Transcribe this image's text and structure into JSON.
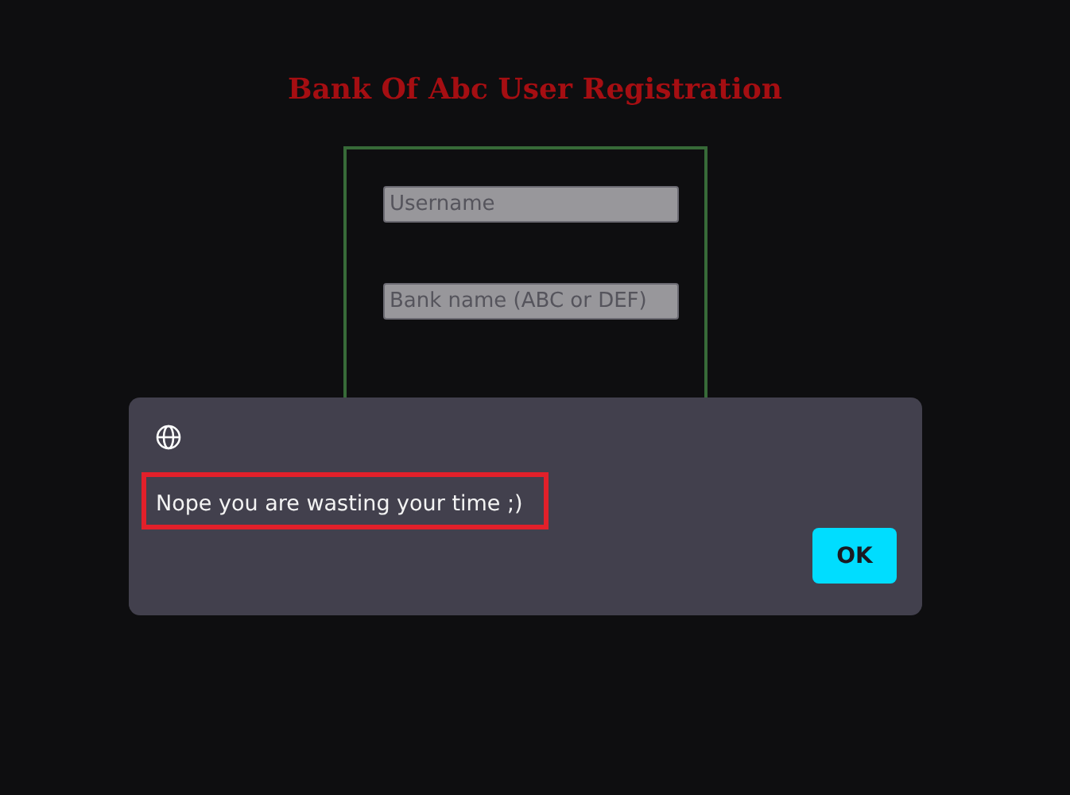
{
  "page": {
    "title": "Bank Of Abc User Registration"
  },
  "form": {
    "fields": [
      {
        "placeholder": "Username"
      },
      {
        "placeholder": "Bank name (ABC or DEF)"
      }
    ]
  },
  "dialog": {
    "message": "Nope you are wasting your time ;)",
    "highlighted": true,
    "buttons": [
      "OK"
    ]
  }
}
